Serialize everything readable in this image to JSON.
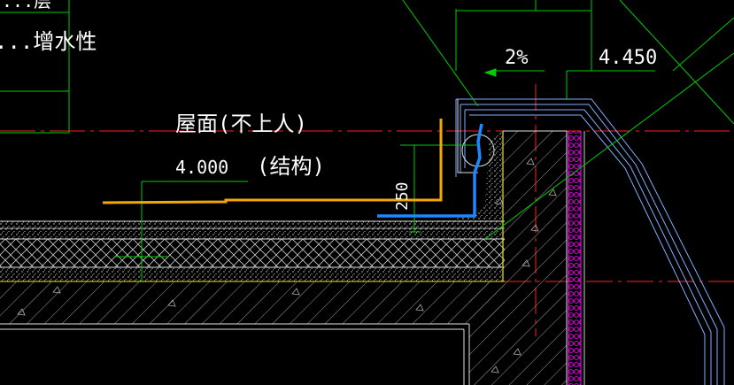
{
  "labels": {
    "partial_top": "...层",
    "partial_mid": "...增水性",
    "roof_title": "屋面(不上人)",
    "roof_elevation": "4.000",
    "roof_note": "(结构)",
    "slope": "2%",
    "top_elevation": "4.450",
    "height_dim": "250"
  },
  "colors": {
    "background": "#000000",
    "dim_green": "#00cc00",
    "axis_red": "#ff2020",
    "annotation_yellow": "#f2a800",
    "annotation_blue": "#1e88ff",
    "outline_cyan": "#7fb0ff",
    "insulation_magenta": "#ff00ff",
    "text_white": "#ffffff",
    "hatch_grey": "#bfbfbf",
    "edge_yellow": "#e0e000"
  }
}
